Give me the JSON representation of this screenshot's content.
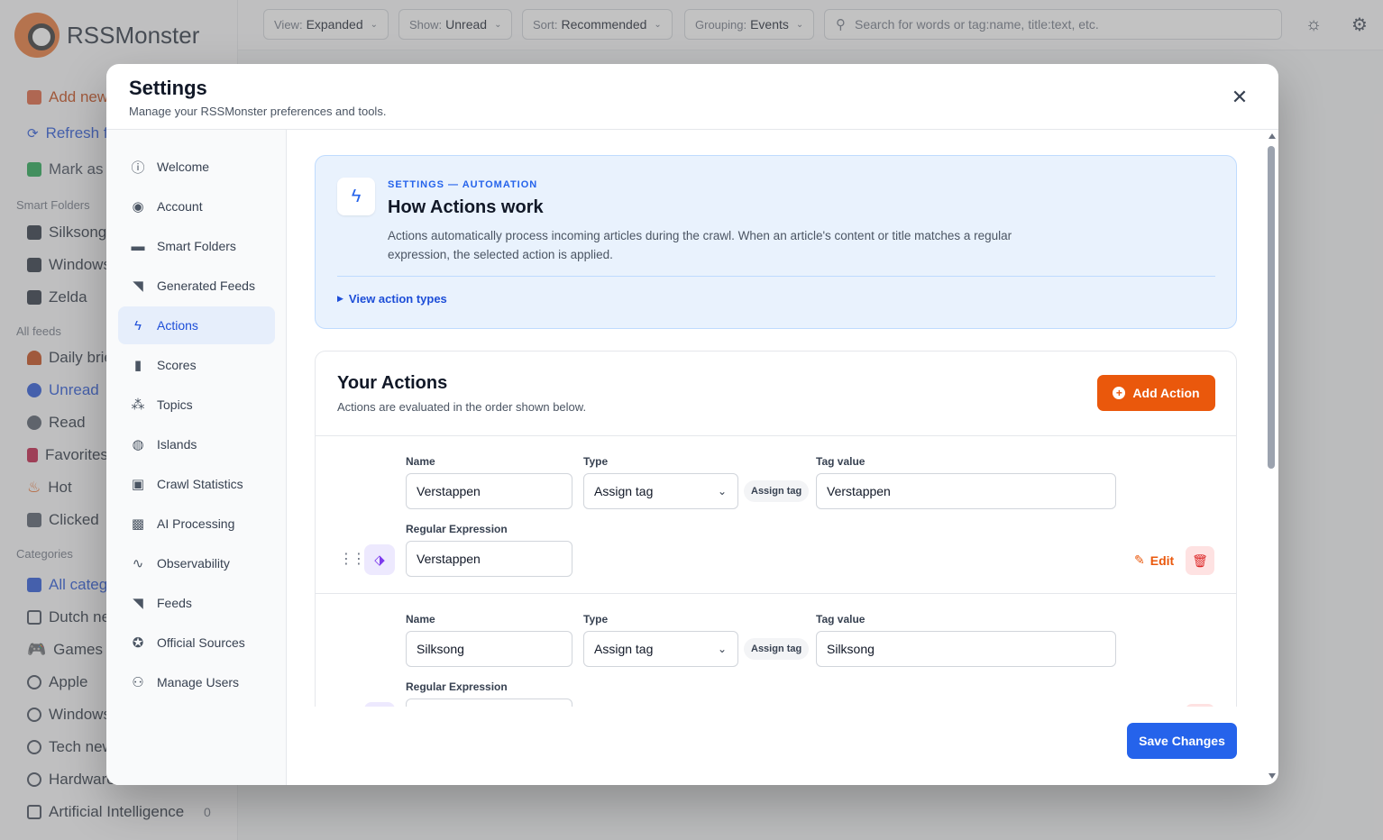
{
  "app": {
    "name": "RSSMonster",
    "sidebar": {
      "actions": [
        "Add new",
        "Refresh f",
        "Mark as"
      ],
      "smart_folders_title": "Smart Folders",
      "smart_folders": [
        "Silksong",
        "Windows",
        "Zelda"
      ],
      "all_feeds_title": "All feeds",
      "feeds": [
        "Daily brie",
        "Unread",
        "Read",
        "Favorites",
        "Hot",
        "Clicked"
      ],
      "categories_title": "Categories",
      "categories": [
        "All categ",
        "Dutch ne",
        "Games",
        "Apple",
        "Windows",
        "Tech new",
        "Hardware",
        "Artificial Intelligence"
      ],
      "ai_count": "0"
    },
    "topbar": {
      "view_key": "View:",
      "view_value": "Expanded",
      "show_key": "Show:",
      "show_value": "Unread",
      "sort_key": "Sort:",
      "sort_value": "Recommended",
      "group_key": "Grouping:",
      "group_value": "Events",
      "search_placeholder": "Search for words or tag:name, title:text, etc."
    }
  },
  "modal": {
    "title": "Settings",
    "subtitle": "Manage your RSSMonster preferences and tools.",
    "nav": [
      {
        "label": "Welcome",
        "icon": "info-icon"
      },
      {
        "label": "Account",
        "icon": "user-icon"
      },
      {
        "label": "Smart Folders",
        "icon": "folder-icon"
      },
      {
        "label": "Generated Feeds",
        "icon": "rss-icon"
      },
      {
        "label": "Actions",
        "icon": "bolt-icon"
      },
      {
        "label": "Scores",
        "icon": "bar-chart-icon"
      },
      {
        "label": "Topics",
        "icon": "sitemap-icon"
      },
      {
        "label": "Islands",
        "icon": "compass-icon"
      },
      {
        "label": "Crawl Statistics",
        "icon": "clipboard-icon"
      },
      {
        "label": "AI Processing",
        "icon": "chip-icon"
      },
      {
        "label": "Observability",
        "icon": "pulse-icon"
      },
      {
        "label": "Feeds",
        "icon": "rss-icon"
      },
      {
        "label": "Official Sources",
        "icon": "badge-check-icon"
      },
      {
        "label": "Manage Users",
        "icon": "users-icon"
      }
    ],
    "info": {
      "eyebrow": "SETTINGS — AUTOMATION",
      "title": "How Actions work",
      "text": "Actions automatically process incoming articles during the crawl. When an article's content or title matches a regular expression, the selected action is applied.",
      "toggle": "View action types"
    },
    "actions": {
      "title": "Your Actions",
      "subtitle": "Actions are evaluated in the order shown below.",
      "add_label": "Add Action",
      "labels": {
        "name": "Name",
        "type": "Type",
        "tag_value": "Tag value",
        "regex": "Regular Expression"
      },
      "edit_label": "Edit",
      "items": [
        {
          "name": "Verstappen",
          "type": "Assign tag",
          "badge": "Assign tag",
          "tag_value": "Verstappen",
          "regex": "Verstappen"
        },
        {
          "name": "Silksong",
          "type": "Assign tag",
          "badge": "Assign tag",
          "tag_value": "Silksong",
          "regex": ""
        }
      ]
    },
    "save_label": "Save Changes"
  },
  "colors": {
    "primary": "#2563eb",
    "accent": "#ea580c",
    "active_nav_bg": "#e6eefb"
  }
}
